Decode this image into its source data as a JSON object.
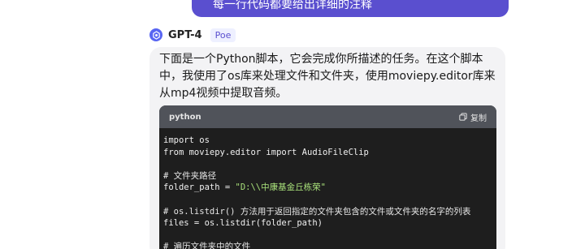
{
  "user_message": {
    "text": "每一行代码都要给出详细的注释"
  },
  "bot": {
    "name": "GPT-4",
    "badge": "Poe",
    "avatar_icon": "gpt-avatar-icon",
    "message": "下面是一个Python脚本，它会完成你所描述的任务。在这个脚本中，我使用了os库来处理文件和文件夹，使用moviepy.editor库来从mp4视频中提取音频。"
  },
  "code_block": {
    "language": "python",
    "copy_label": "复制",
    "copy_icon": "copy-icon",
    "lines": [
      "import os",
      "from moviepy.editor import AudioFileClip",
      "",
      "# 文件夹路径",
      "folder_path = \"D:\\\\中康基金丘栋荣\"",
      "",
      "# os.listdir() 方法用于返回指定的文件夹包含的文件或文件夹的名字的列表",
      "files = os.listdir(folder_path)",
      "",
      "# 遍历文件夹中的文件"
    ]
  },
  "colors": {
    "user_bubble": "#5a4fcf",
    "code_bg": "#1e1e1e",
    "code_header": "#50535a",
    "string": "#a8e07a"
  }
}
